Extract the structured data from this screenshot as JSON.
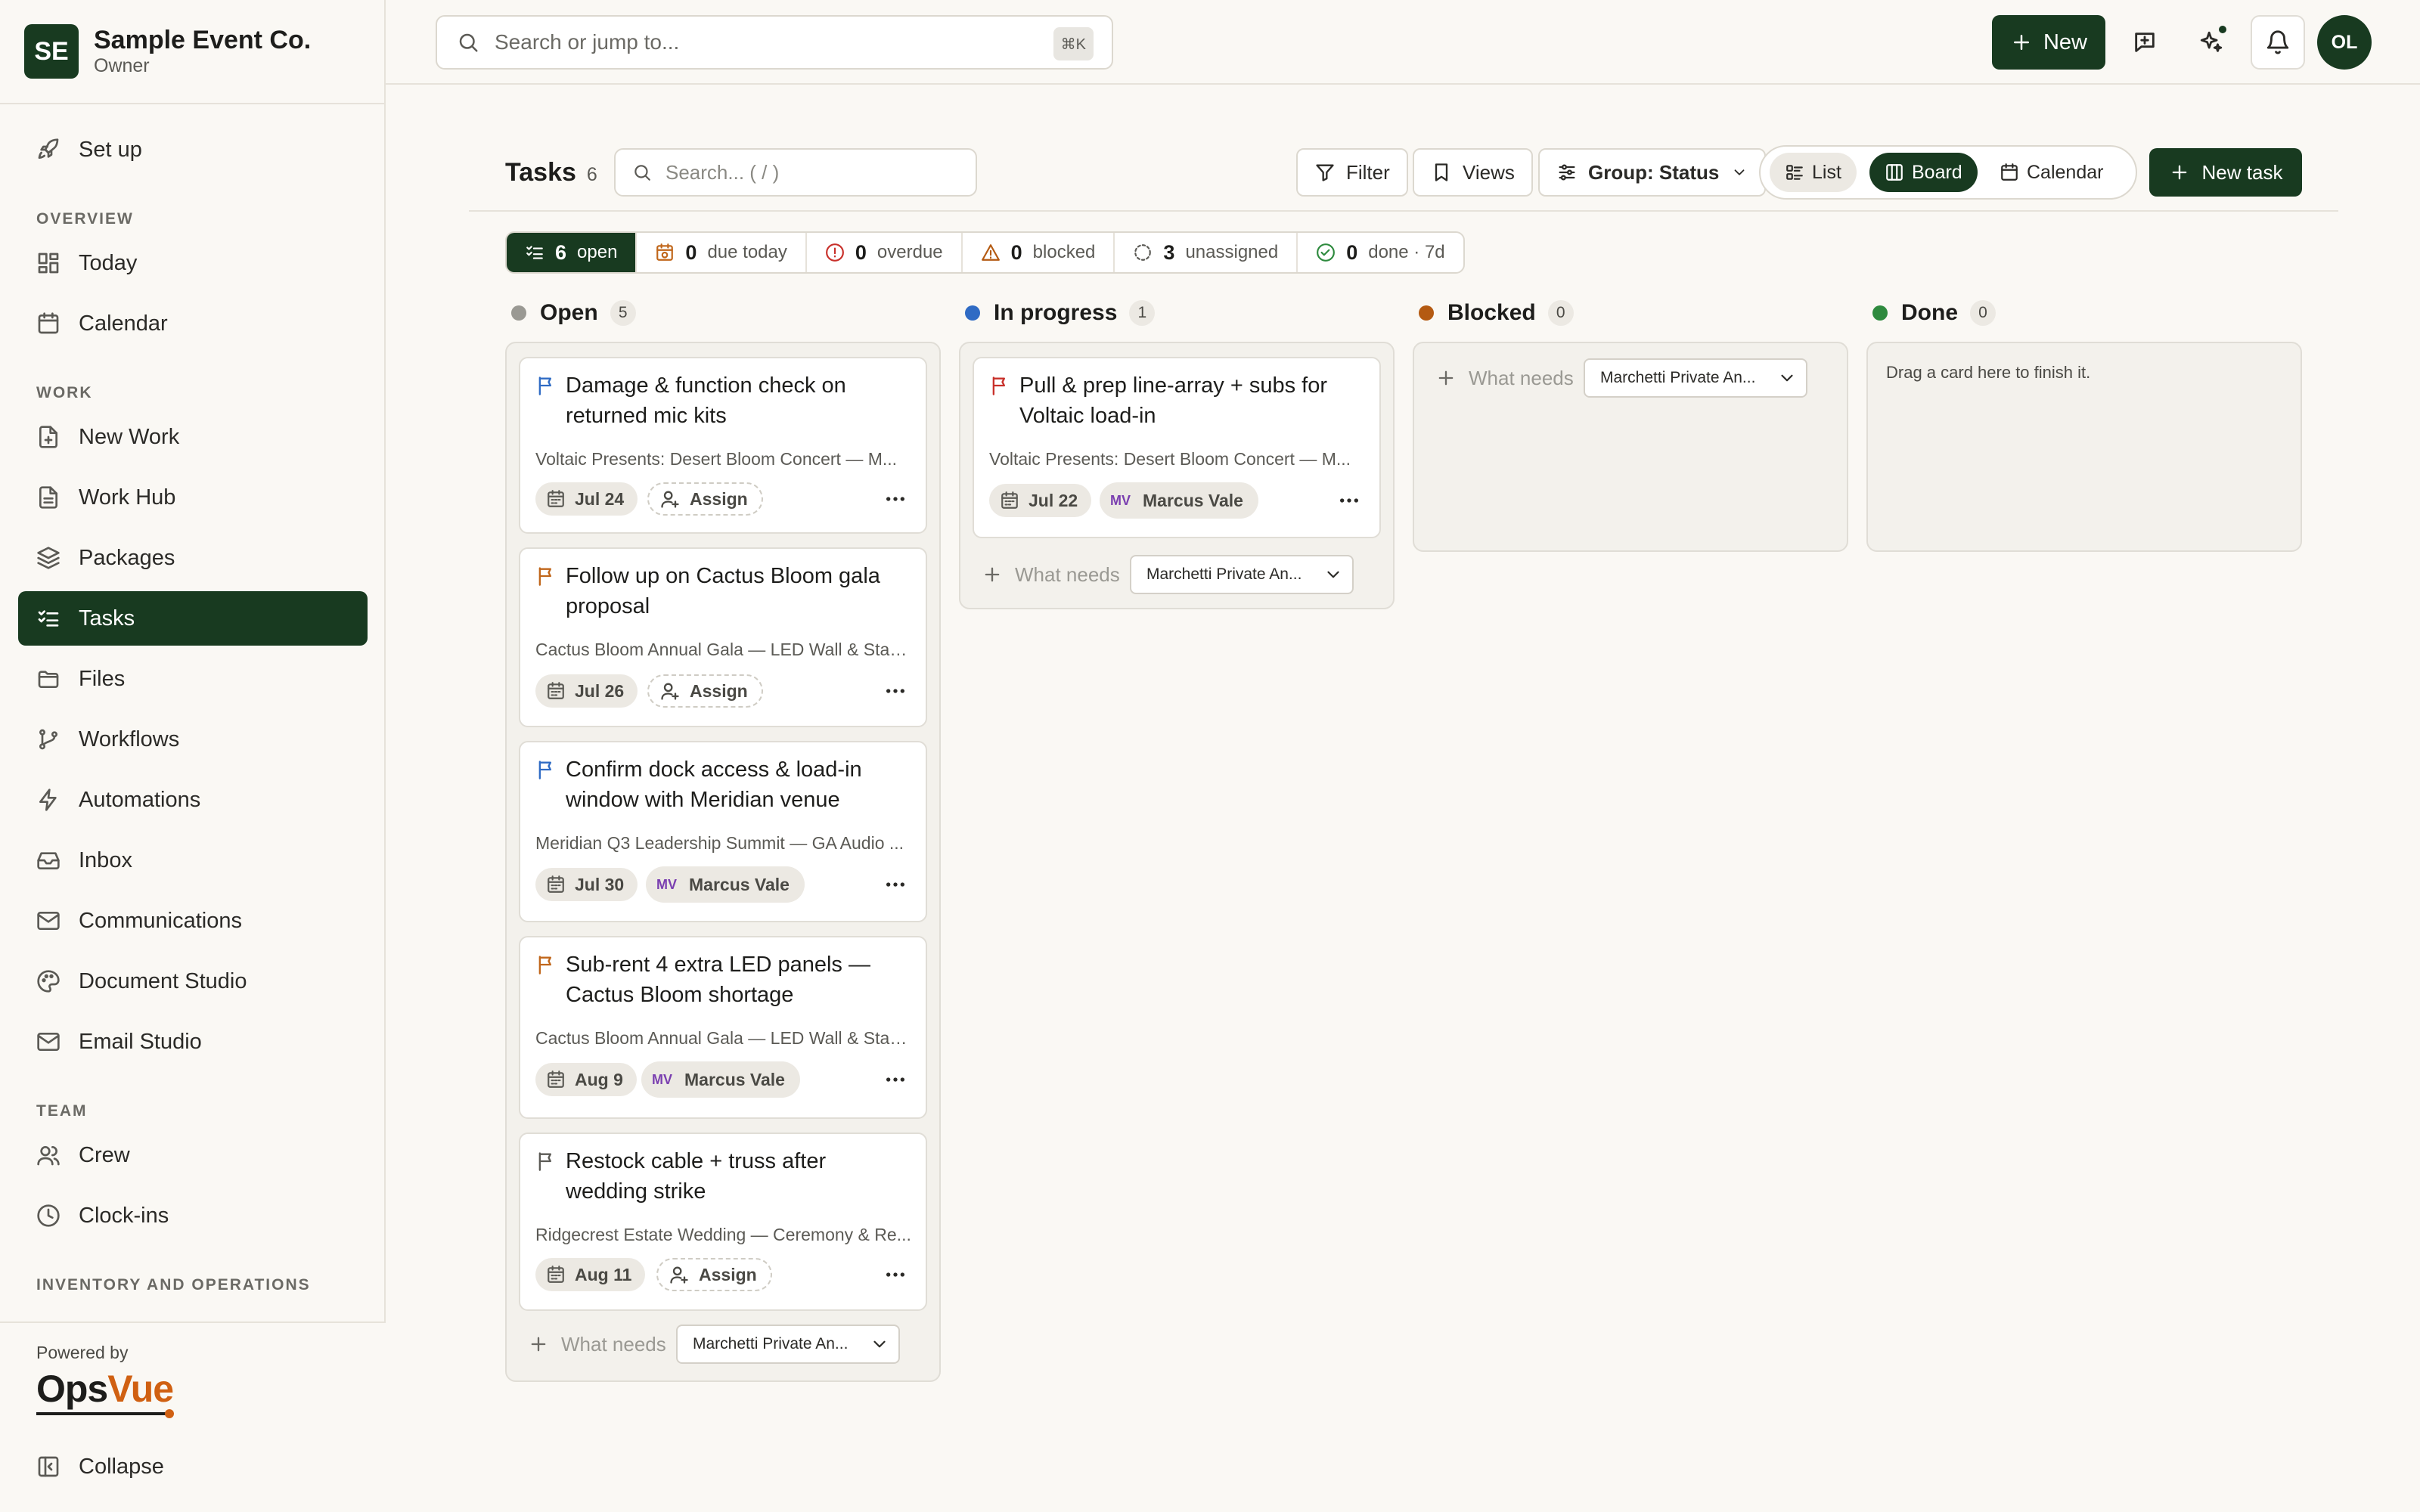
{
  "org": {
    "initials": "SE",
    "name": "Sample Event Co.",
    "role": "Owner"
  },
  "sidebar": {
    "setup": "Set up",
    "sections": {
      "overview": "OVERVIEW",
      "work": "WORK",
      "team": "TEAM",
      "inventory": "INVENTORY AND OPERATIONS"
    },
    "items": {
      "today": "Today",
      "calendar": "Calendar",
      "new_work": "New Work",
      "work_hub": "Work Hub",
      "packages": "Packages",
      "tasks": "Tasks",
      "files": "Files",
      "workflows": "Workflows",
      "automations": "Automations",
      "inbox": "Inbox",
      "communications": "Communications",
      "document_studio": "Document Studio",
      "email_studio": "Email Studio",
      "crew": "Crew",
      "clock_ins": "Clock-ins"
    },
    "powered_by": "Powered by",
    "brand_a": "Ops",
    "brand_b": "Vue",
    "collapse": "Collapse"
  },
  "topbar": {
    "search_placeholder": "Search or jump to...",
    "shortcut": "⌘K",
    "new_label": "New",
    "avatar": "OL"
  },
  "toolbar": {
    "title": "Tasks",
    "count": "6",
    "search_placeholder": "Search...  ( / )",
    "filter": "Filter",
    "views": "Views",
    "group": "Group: Status",
    "view_list": "List",
    "view_board": "Board",
    "view_calendar": "Calendar",
    "new_task": "New task"
  },
  "stats": [
    {
      "num": "6",
      "label": "open"
    },
    {
      "num": "0",
      "label": "due today"
    },
    {
      "num": "0",
      "label": "overdue"
    },
    {
      "num": "0",
      "label": "blocked"
    },
    {
      "num": "3",
      "label": "unassigned"
    },
    {
      "num": "0",
      "label": "done · 7d"
    }
  ],
  "columns": [
    {
      "name": "Open",
      "count": "5",
      "color": "#9a9993"
    },
    {
      "name": "In progress",
      "count": "1",
      "color": "#2f6bc4"
    },
    {
      "name": "Blocked",
      "count": "0",
      "color": "#b45a12"
    },
    {
      "name": "Done",
      "count": "0",
      "color": "#2e8a3e"
    }
  ],
  "cards": [
    {
      "title": "Damage & function check on returned mic kits",
      "project": "Voltaic Presents: Desert Bloom Concert — M...",
      "date": "Jul 24",
      "assignee": "Assign",
      "flag_color": "#2f6bc4"
    },
    {
      "title": "Follow up on Cactus Bloom gala proposal",
      "project": "Cactus Bloom Annual Gala — LED Wall & Stag...",
      "date": "Jul 26",
      "assignee": "Assign",
      "flag_color": "#c0661a"
    },
    {
      "title": "Confirm dock access & load-in window with Meridian venue",
      "project": "Meridian Q3 Leadership Summit — GA Audio ...",
      "date": "Jul 30",
      "assignee": "Marcus Vale",
      "assignee_initials": "MV",
      "flag_color": "#2f6bc4"
    },
    {
      "title": "Sub-rent 4 extra LED panels — Cactus Bloom shortage",
      "project": "Cactus Bloom Annual Gala — LED Wall & Stag...",
      "date": "Aug 9",
      "assignee": "Marcus Vale",
      "assignee_initials": "MV",
      "flag_color": "#c0661a"
    },
    {
      "title": "Restock cable + truss after wedding strike",
      "project": "Ridgecrest Estate Wedding — Ceremony & Re...",
      "date": "Aug 11",
      "assignee": "Assign",
      "flag_color": "#5b5a55"
    },
    {
      "title": "Pull & prep line-array + subs for Voltaic load-in",
      "project": "Voltaic Presents: Desert Bloom Concert — M...",
      "date": "Jul 22",
      "assignee": "Marcus Vale",
      "assignee_initials": "MV",
      "flag_color": "#c8302a"
    }
  ],
  "quick_add": {
    "placeholder": "What needs doing?",
    "project": "Marchetti Private An..."
  },
  "done_hint": "Drag a card here to finish it."
}
